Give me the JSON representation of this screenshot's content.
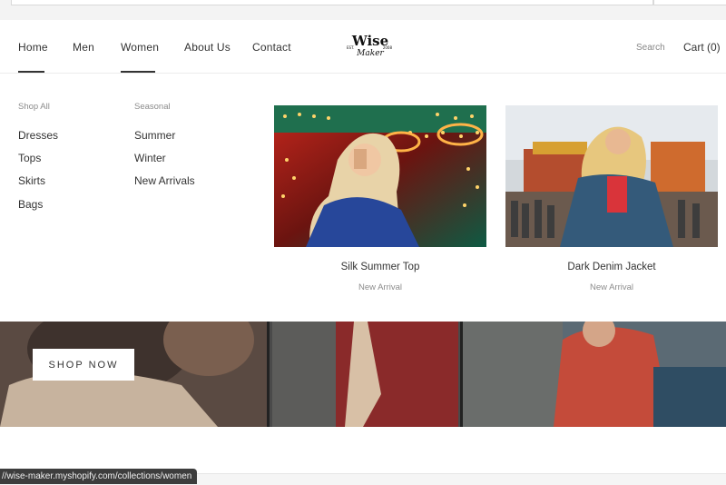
{
  "nav": {
    "items": [
      {
        "label": "Home"
      },
      {
        "label": "Men"
      },
      {
        "label": "Women"
      },
      {
        "label": "About Us"
      },
      {
        "label": "Contact"
      }
    ],
    "search_label": "Search",
    "cart_label": "Cart (0)"
  },
  "logo": {
    "est": "EST.",
    "year": "2008",
    "wise": "Wise",
    "maker": "Maker"
  },
  "menu": {
    "shop_all": {
      "heading": "Shop All",
      "items": [
        "Dresses",
        "Tops",
        "Skirts",
        "Bags"
      ]
    },
    "seasonal": {
      "heading": "Seasonal",
      "items": [
        "Summer",
        "Winter",
        "New Arrivals"
      ]
    },
    "products": [
      {
        "title": "Silk Summer Top",
        "subtitle": "New Arrival"
      },
      {
        "title": "Dark Denim Jacket",
        "subtitle": "New Arrival"
      }
    ]
  },
  "hero": {
    "button_label": "SHOP NOW"
  },
  "status_bar": {
    "url": "//wise-maker.myshopify.com/collections/women"
  },
  "colors": {
    "text": "#333333",
    "muted": "#8c8c8c",
    "status_bg": "#3d3d3d"
  }
}
